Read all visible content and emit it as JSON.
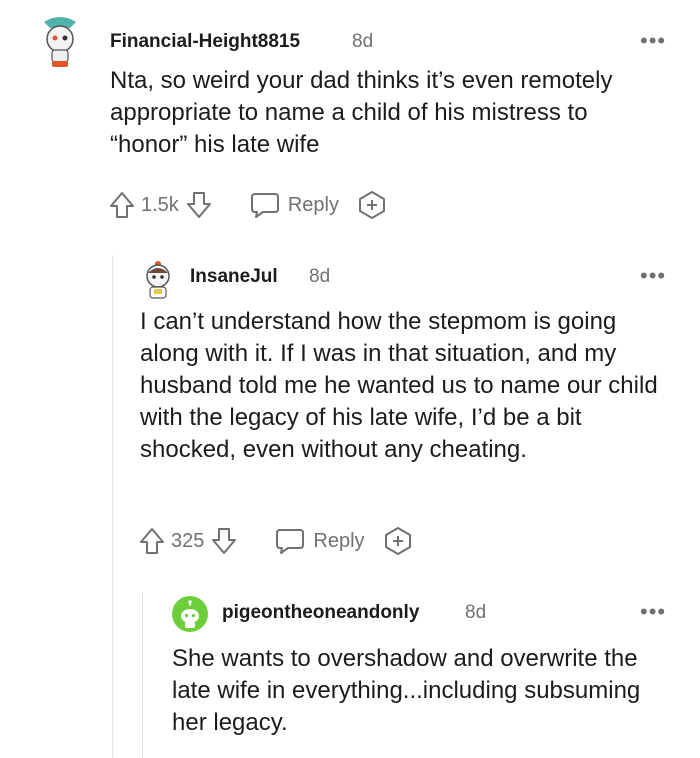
{
  "comments": [
    {
      "author": "Financial-Height8815",
      "age": "8d",
      "more": "•••",
      "text": "Nta, so weird your dad thinks it’s even remotely appropriate to name a child of his mistress to “honor” his late wife",
      "votes": "1.5k",
      "reply_label": "Reply"
    },
    {
      "author": "InsaneJul",
      "age": "8d",
      "more": "•••",
      "text": "I can’t understand how the stepmom is going along with it. If I was in that situation, and my husband told me he wanted us to name our child with the legacy of his late wife, I’d be a bit shocked, even without any cheating.",
      "votes": "325",
      "reply_label": "Reply"
    },
    {
      "author": "pigeontheoneandonly",
      "age": "8d",
      "more": "•••",
      "text": "She wants to overshadow and overwrite the late wife in everything...including subsuming her legacy."
    }
  ],
  "icons": {
    "upvote": "upvote-icon",
    "downvote": "downvote-icon",
    "reply": "reply-bubble-icon",
    "award": "award-plus-icon",
    "more": "more-options-icon"
  },
  "colors": {
    "text": "#1c1c1c",
    "meta": "#6f7173",
    "thread_line": "#e3e6e8",
    "avatar_green": "#6ccf3a"
  }
}
